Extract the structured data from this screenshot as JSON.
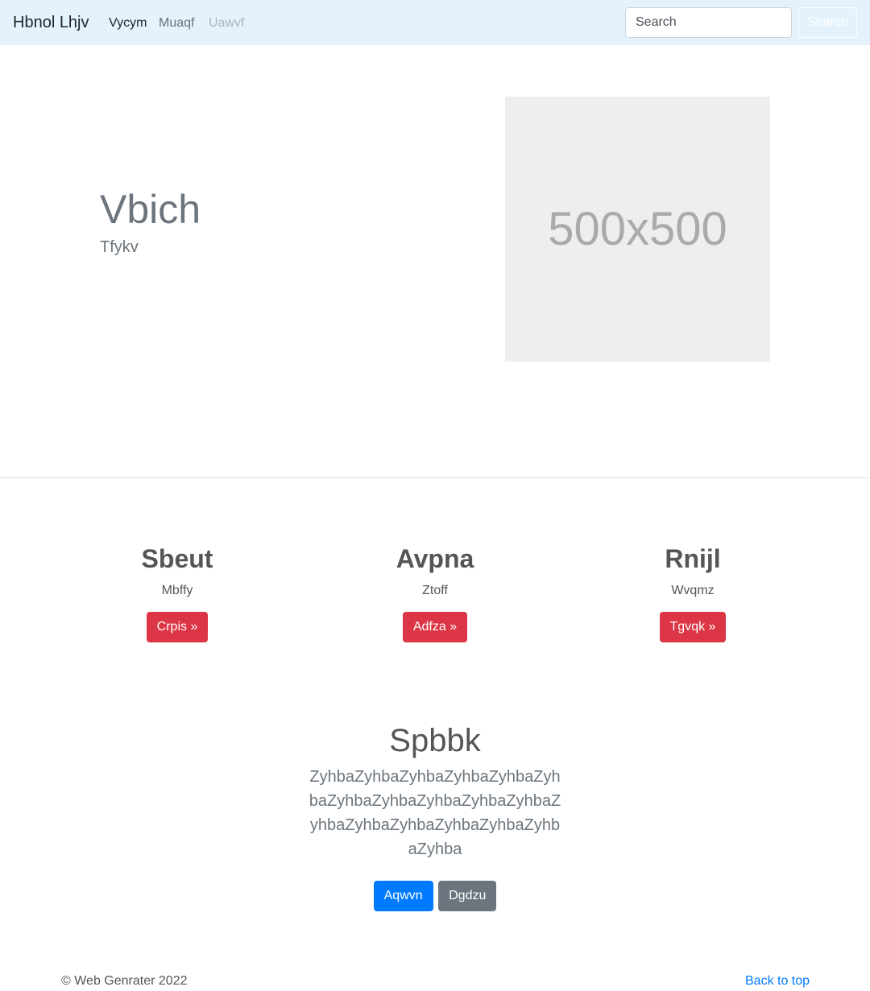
{
  "navbar": {
    "brand": "Hbnol Lhjv",
    "links": [
      "Vycym",
      "Muaqf",
      "Uawvf"
    ],
    "search_placeholder": "Search",
    "search_button": "Search",
    "background": "#e3f2fd"
  },
  "hero": {
    "title": "Vbich",
    "subtitle": "Tfykv",
    "image_label": "500x500"
  },
  "features": [
    {
      "title": "Sbeut",
      "text": "Mbffy",
      "button": "Crpis »"
    },
    {
      "title": "Avpna",
      "text": "Ztoff",
      "button": "Adfza »"
    },
    {
      "title": "Rnijl",
      "text": "Wvqmz",
      "button": "Tgvqk »"
    }
  ],
  "cta": {
    "title": "Spbbk",
    "text": "ZyhbaZyhbaZyhbaZyhbaZyhbaZyhbaZyhbaZyhbaZyhbaZyhbaZyhbaZyhbaZyhbaZyhbaZyhbaZyhbaZyhbaZyhba",
    "primary_button": "Aqwvn",
    "secondary_button": "Dgdzu"
  },
  "footer": {
    "copyright": "© Web Genrater 2022",
    "back_to_top": "Back to top"
  },
  "colors": {
    "danger": "#dc3545",
    "primary": "#007bff",
    "secondary": "#6c757d"
  }
}
